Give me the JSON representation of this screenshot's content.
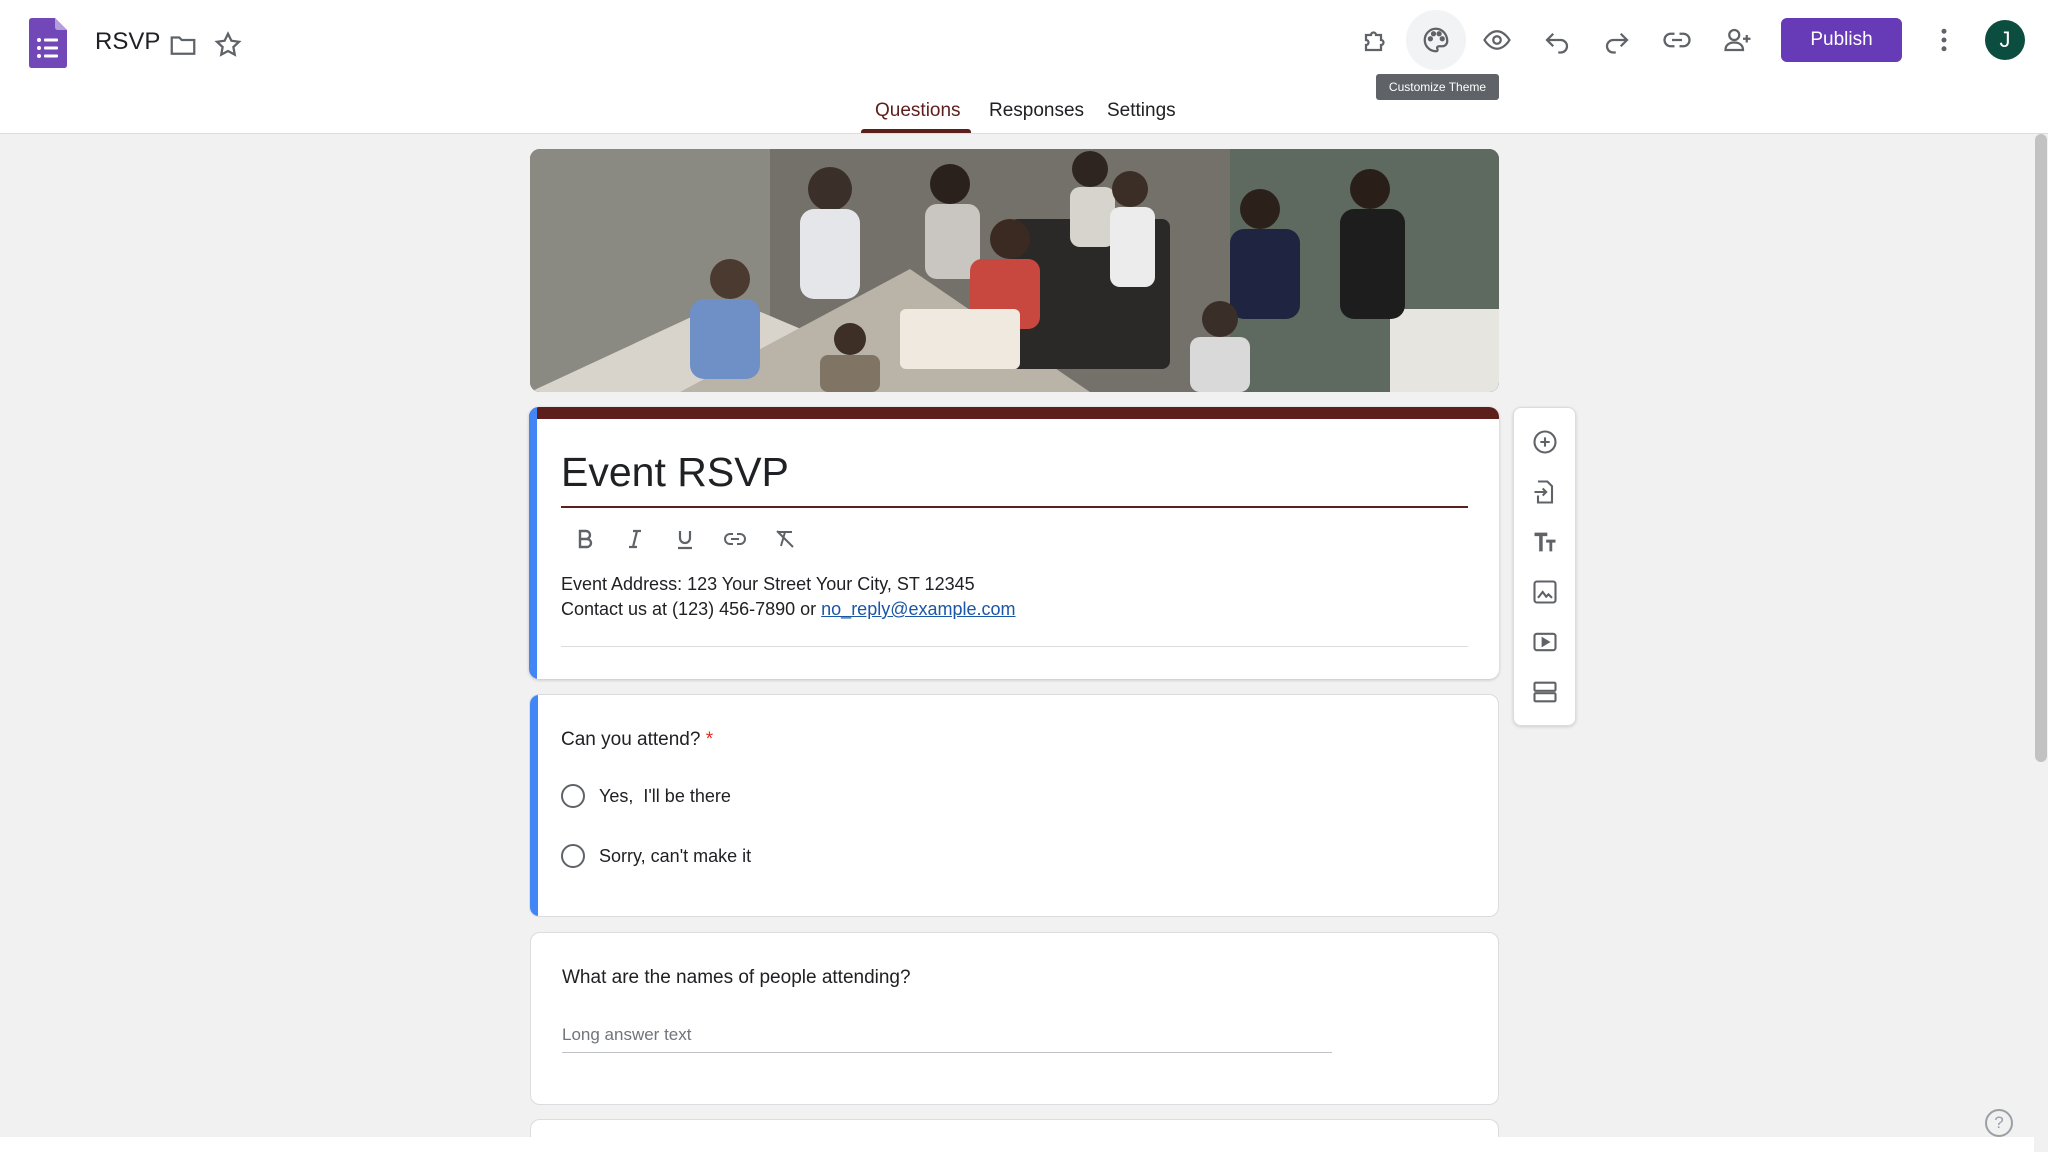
{
  "app": {
    "icon": "google-forms-icon",
    "document_title": "RSVP"
  },
  "header": {
    "icons": [
      "folder-icon",
      "star-icon",
      "add-ons-icon",
      "palette-icon",
      "preview-eye-icon",
      "undo-icon",
      "redo-icon",
      "link-icon",
      "add-collaborator-icon",
      "more-vert-icon"
    ],
    "publish_label": "Publish",
    "avatar_letter": "J",
    "avatar_color": "#0b4d3f",
    "tooltip": "Customize Theme"
  },
  "tabs": [
    {
      "label": "Questions",
      "active": true
    },
    {
      "label": "Responses",
      "active": false
    },
    {
      "label": "Settings",
      "active": false
    }
  ],
  "theme": {
    "accent": "#5d1f1c",
    "focus_bar": "#4285f4",
    "button": "#673ab7",
    "background": "#f1f1f1"
  },
  "form": {
    "title": "Event RSVP",
    "format_tools": [
      "bold-icon",
      "italic-icon",
      "underline-icon",
      "link-icon",
      "clear-formatting-icon"
    ],
    "description_line1": "Event Address: 123 Your Street Your City, ST 12345",
    "description_line2_prefix": "Contact us at (123) 456-7890 or ",
    "description_email": "no_reply@example.com"
  },
  "questions": [
    {
      "title": "Can you attend?",
      "required": true,
      "required_mark": "*",
      "type": "multiple-choice",
      "options": [
        "Yes,  I'll be there",
        "Sorry, can't make it"
      ]
    },
    {
      "title": "What are the names of people attending?",
      "required": false,
      "type": "paragraph",
      "placeholder": "Long answer text"
    }
  ],
  "side_toolbar": [
    "add-question-icon",
    "import-questions-icon",
    "add-title-icon",
    "add-image-icon",
    "add-video-icon",
    "add-section-icon"
  ],
  "help_icon": "?"
}
